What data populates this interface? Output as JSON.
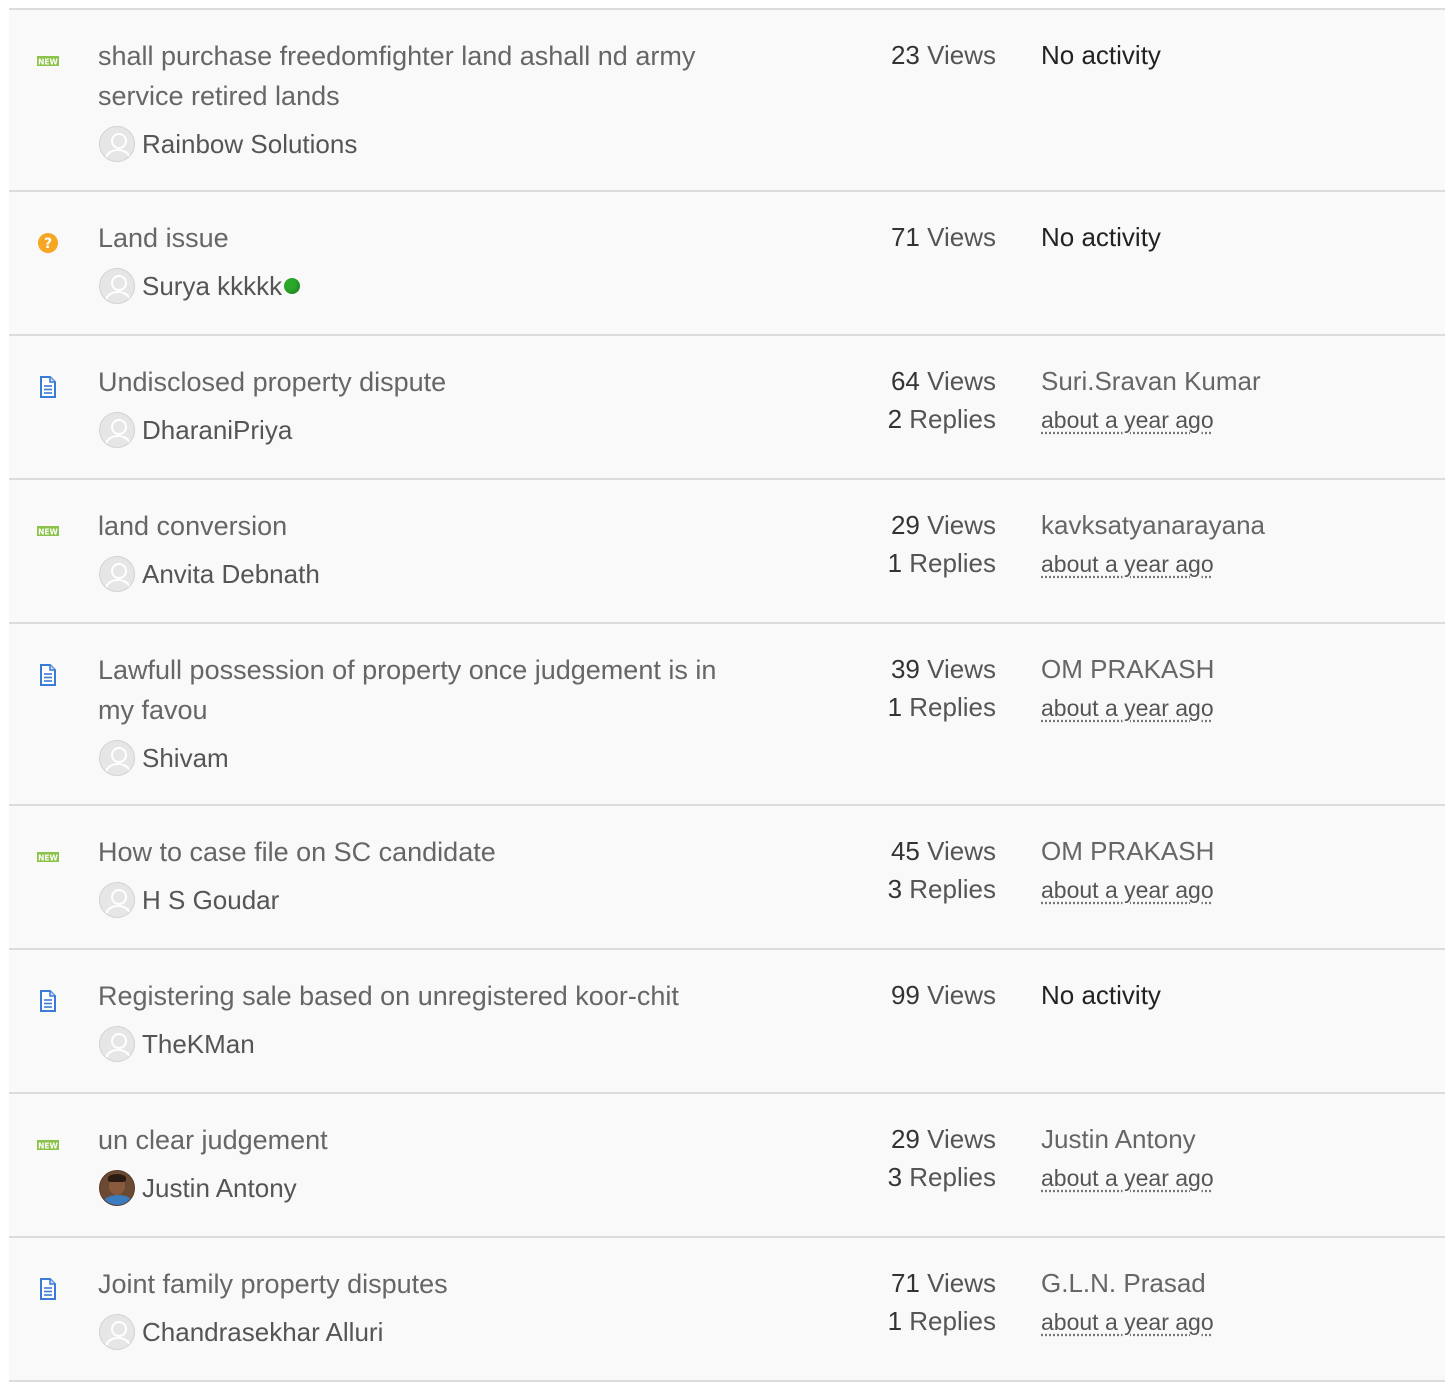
{
  "topics": [
    {
      "icon": "new-icon",
      "title": "shall purchase freedomfighter land ashall nd army service retired lands",
      "author": "Rainbow Solutions",
      "avatar": "default",
      "online": false,
      "views": "23",
      "views_label": "Views",
      "replies": "",
      "replies_label": "",
      "last_user": "No activity",
      "last_time": ""
    },
    {
      "icon": "question-icon",
      "title": "Land issue",
      "author": "Surya kkkkk",
      "avatar": "default",
      "online": true,
      "views": "71",
      "views_label": "Views",
      "replies": "",
      "replies_label": "",
      "last_user": "No activity",
      "last_time": ""
    },
    {
      "icon": "document-icon",
      "title": "Undisclosed property dispute",
      "author": "DharaniPriya",
      "avatar": "default",
      "online": false,
      "views": "64",
      "views_label": "Views",
      "replies": "2",
      "replies_label": "Replies",
      "last_user": "Suri.Sravan Kumar",
      "last_time": "about a year ago"
    },
    {
      "icon": "new-icon",
      "title": "land conversion",
      "author": "Anvita Debnath",
      "avatar": "default",
      "online": false,
      "views": "29",
      "views_label": "Views",
      "replies": "1",
      "replies_label": "Replies",
      "last_user": "kavksatyanarayana",
      "last_time": "about a year ago"
    },
    {
      "icon": "document-icon",
      "title": "Lawfull possession of property once judgement is in my favou",
      "author": "Shivam",
      "avatar": "default",
      "online": false,
      "views": "39",
      "views_label": "Views",
      "replies": "1",
      "replies_label": "Replies",
      "last_user": "OM PRAKASH",
      "last_time": "about a year ago"
    },
    {
      "icon": "new-icon",
      "title": "How to case file on SC candidate",
      "author": "H S Goudar",
      "avatar": "default",
      "online": false,
      "views": "45",
      "views_label": "Views",
      "replies": "3",
      "replies_label": "Replies",
      "last_user": "OM PRAKASH",
      "last_time": "about a year ago"
    },
    {
      "icon": "document-icon",
      "title": "Registering sale based on unregistered koor-chit",
      "author": "TheKMan",
      "avatar": "default",
      "online": false,
      "views": "99",
      "views_label": "Views",
      "replies": "",
      "replies_label": "",
      "last_user": "No activity",
      "last_time": ""
    },
    {
      "icon": "new-icon",
      "title": "un clear judgement",
      "author": "Justin Antony",
      "avatar": "photo",
      "online": false,
      "views": "29",
      "views_label": "Views",
      "replies": "3",
      "replies_label": "Replies",
      "last_user": "Justin Antony",
      "last_time": "about a year ago"
    },
    {
      "icon": "document-icon",
      "title": "Joint family property disputes",
      "author": "Chandrasekhar Alluri",
      "avatar": "default",
      "online": false,
      "views": "71",
      "views_label": "Views",
      "replies": "1",
      "replies_label": "Replies",
      "last_user": "G.L.N. Prasad",
      "last_time": "about a year ago"
    }
  ],
  "colors": {
    "new_badge": "#8bc34a",
    "question": "#f5a623",
    "document": "#3a7bd5",
    "online": "#2aa82a"
  }
}
